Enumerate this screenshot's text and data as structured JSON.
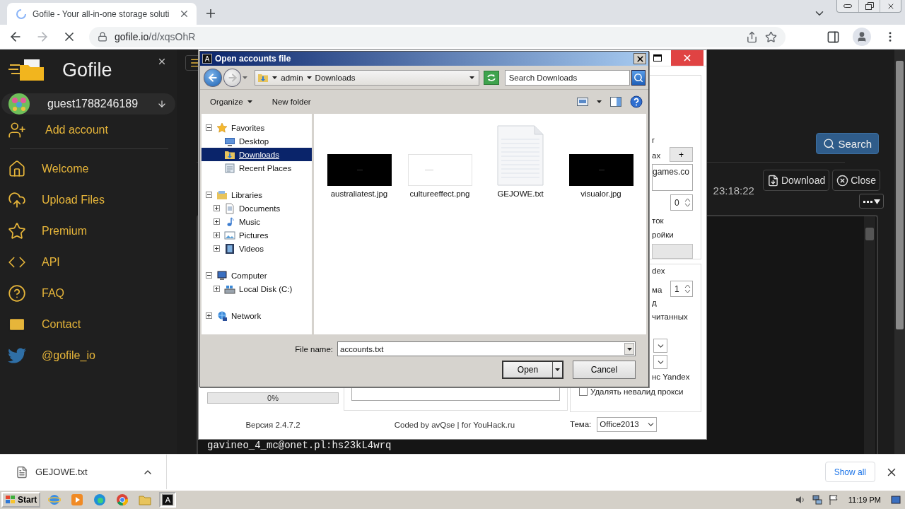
{
  "browser": {
    "tab": {
      "title": "Gofile - Your all-in-one storage soluti",
      "loading": true
    },
    "url": {
      "host": "gofile.io",
      "path": "/d/xqsOhR"
    }
  },
  "sidebar": {
    "brand": "Gofile",
    "account": {
      "name": "guest1788246189"
    },
    "add_account": "Add account",
    "items": [
      {
        "label": "Welcome",
        "kind": "home"
      },
      {
        "label": "Upload Files",
        "kind": "upload"
      },
      {
        "label": "Premium",
        "kind": "premium"
      },
      {
        "label": "API",
        "kind": "api"
      },
      {
        "label": "FAQ",
        "kind": "faq"
      },
      {
        "label": "Contact",
        "kind": "contact"
      },
      {
        "label": "@gofile_io",
        "kind": "twitter"
      }
    ]
  },
  "page": {
    "search": "Search",
    "timestamp": "23:18:22",
    "actions": [
      {
        "label": "Download",
        "kind": "download"
      },
      {
        "label": "Close",
        "kind": "close"
      }
    ],
    "content_line": "gavineo_4_mc@onet.pl:hs23kL4wrq"
  },
  "app_window": {
    "group_1": {
      "labels": [
        "r",
        "ax"
      ],
      "add_button": "+",
      "field_value": "games.co",
      "spinner": "0",
      "options": [
        "ток",
        "ройки"
      ]
    },
    "group_2": {
      "title": "dex",
      "spinner_label": "ма",
      "spinner": "1",
      "labels": [
        "д",
        "читанных"
      ],
      "last_label": "нс Yandex"
    },
    "checkbox": {
      "label": "Удалять невалид прокси",
      "checked": false
    },
    "progress": {
      "text": "0%",
      "level": 0
    },
    "version": "Версия 2.4.7.2",
    "credits": "Coded by avQse | for YouHack.ru",
    "theme": {
      "label": "Тема:",
      "value": "Office2013"
    }
  },
  "dialog": {
    "icon_letter": "A",
    "title": "Open accounts file",
    "path": [
      "admin",
      "Downloads"
    ],
    "search_placeholder": "Search Downloads",
    "toolbar": [
      "Organize",
      "New folder"
    ],
    "nav": [
      {
        "label": "Favorites",
        "kind": "favorites",
        "expanded": true,
        "selected": false,
        "children": [
          {
            "label": "Desktop",
            "kind": "desktop",
            "selected": false
          },
          {
            "label": "Downloads",
            "kind": "downloads",
            "selected": true
          },
          {
            "label": "Recent Places",
            "kind": "recent",
            "selected": false
          }
        ]
      },
      {
        "label": "Libraries",
        "kind": "libraries",
        "expanded": true,
        "selected": false,
        "children": [
          {
            "label": "Documents",
            "kind": "documents",
            "expanded": false,
            "selected": false
          },
          {
            "label": "Music",
            "kind": "music",
            "expanded": false,
            "selected": false
          },
          {
            "label": "Pictures",
            "kind": "pictures",
            "expanded": false,
            "selected": false
          },
          {
            "label": "Videos",
            "kind": "videos",
            "expanded": false,
            "selected": false
          }
        ]
      },
      {
        "label": "Computer",
        "kind": "computer",
        "expanded": true,
        "selected": false,
        "children": [
          {
            "label": "Local Disk (C:)",
            "kind": "disk",
            "expanded": false,
            "selected": false
          }
        ]
      },
      {
        "label": "Network",
        "kind": "network",
        "expanded": false,
        "selected": false
      }
    ],
    "files": [
      {
        "name": "australiatest.jpg",
        "kind": "dark"
      },
      {
        "name": "cultureeffect.png",
        "kind": "light"
      },
      {
        "name": "GEJOWE.txt",
        "kind": "text"
      },
      {
        "name": "visualor.jpg",
        "kind": "dark"
      }
    ],
    "file_name_label": "File name:",
    "file_name": "accounts.txt",
    "open": "Open",
    "cancel": "Cancel"
  },
  "download_bar": {
    "file": "GEJOWE.txt",
    "show_all": "Show all"
  },
  "taskbar": {
    "start": "Start",
    "active_app": "A",
    "clock": "11:19 PM"
  }
}
